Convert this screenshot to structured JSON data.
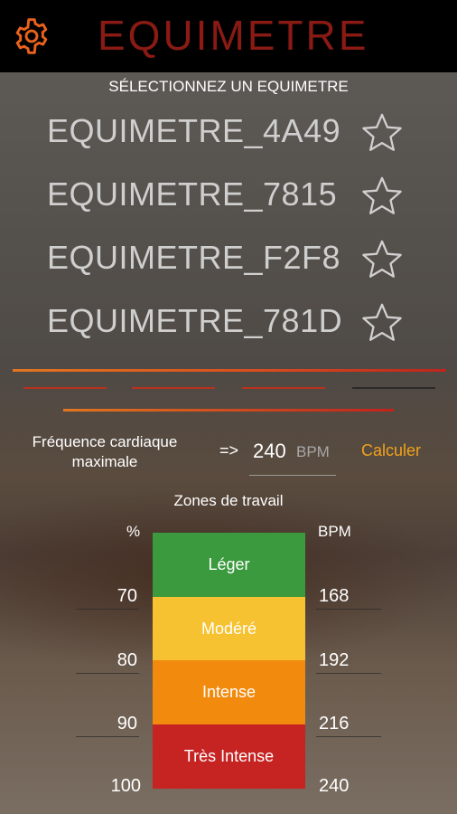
{
  "header": {
    "title": "EQUIMETRE",
    "settings_icon": "gear-icon",
    "accent": "#e8621c"
  },
  "devices": {
    "heading": "SÉLECTIONNEZ UN EQUIMETRE",
    "items": [
      {
        "name": "EQUIMETRE_4A49",
        "favorite_icon": "star-outline-icon"
      },
      {
        "name": "EQUIMETRE_7815",
        "favorite_icon": "star-outline-icon"
      },
      {
        "name": "EQUIMETRE_F2F8",
        "favorite_icon": "star-outline-icon"
      },
      {
        "name": "EQUIMETRE_781D",
        "favorite_icon": "star-outline-icon"
      }
    ]
  },
  "heart_rate": {
    "label": "Fréquence cardiaque maximale",
    "arrow": "=>",
    "value": "240",
    "unit": "BPM",
    "calculate_label": "Calculer"
  },
  "zones": {
    "title": "Zones de travail",
    "percent_header": "%",
    "bpm_header": "BPM",
    "items": [
      {
        "label": "Léger",
        "color": "#3a9a3d"
      },
      {
        "label": "Modéré",
        "color": "#f6c231"
      },
      {
        "label": "Intense",
        "color": "#f28a0e"
      },
      {
        "label": "Très Intense",
        "color": "#c62323"
      }
    ],
    "percent_ticks": [
      "70",
      "80",
      "90",
      "100"
    ],
    "bpm_ticks": [
      "168",
      "192",
      "216",
      "240"
    ]
  }
}
